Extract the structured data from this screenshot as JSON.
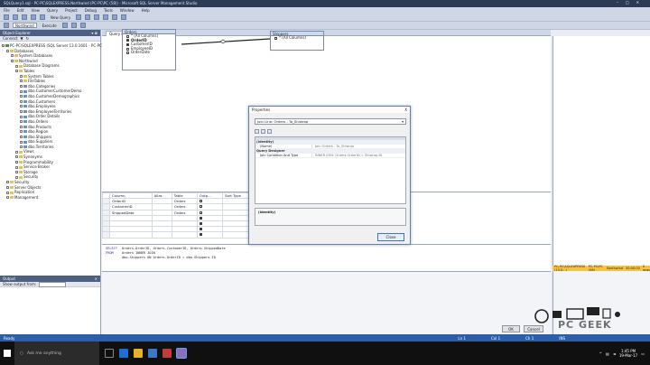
{
  "window": {
    "title": "SQLQuery1.sql - PC-PC\\SQLEXPRESS.Northwind (PC-PC\\PC (58)) - Microsoft SQL Server Management Studio"
  },
  "menu": [
    "File",
    "Edit",
    "View",
    "Query",
    "Project",
    "Debug",
    "Tools",
    "Window",
    "Help"
  ],
  "toolbar": {
    "new_query": "New Query",
    "database": "Northwind",
    "execute": "Execute"
  },
  "object_explorer": {
    "title": "Object Explorer",
    "connect": "Connect",
    "nodes": [
      {
        "label": "PC-PC\\SQLEXPRESS (SQL Server 13.0.1601 - PC-PC\\PC)",
        "level": 0,
        "kind": "srv"
      },
      {
        "label": "Databases",
        "level": 1,
        "kind": "folder"
      },
      {
        "label": "System Databases",
        "level": 2,
        "kind": "folder"
      },
      {
        "label": "Northwind",
        "level": 2,
        "kind": "folder"
      },
      {
        "label": "Database Diagrams",
        "level": 3,
        "kind": "folder"
      },
      {
        "label": "Tables",
        "level": 3,
        "kind": "folder"
      },
      {
        "label": "System Tables",
        "level": 4,
        "kind": "folder"
      },
      {
        "label": "FileTables",
        "level": 4,
        "kind": "folder"
      },
      {
        "label": "dbo.Categories",
        "level": 4,
        "kind": "tbl"
      },
      {
        "label": "dbo.CustomerCustomerDemo",
        "level": 4,
        "kind": "tbl"
      },
      {
        "label": "dbo.CustomerDemographics",
        "level": 4,
        "kind": "tbl"
      },
      {
        "label": "dbo.Customers",
        "level": 4,
        "kind": "tbl"
      },
      {
        "label": "dbo.Employees",
        "level": 4,
        "kind": "tbl"
      },
      {
        "label": "dbo.EmployeeTerritories",
        "level": 4,
        "kind": "tbl"
      },
      {
        "label": "dbo.Order Details",
        "level": 4,
        "kind": "tbl"
      },
      {
        "label": "dbo.Orders",
        "level": 4,
        "kind": "tbl"
      },
      {
        "label": "dbo.Products",
        "level": 4,
        "kind": "tbl"
      },
      {
        "label": "dbo.Region",
        "level": 4,
        "kind": "tbl"
      },
      {
        "label": "dbo.Shippers",
        "level": 4,
        "kind": "tbl"
      },
      {
        "label": "dbo.Suppliers",
        "level": 4,
        "kind": "tbl"
      },
      {
        "label": "dbo.Territories",
        "level": 4,
        "kind": "tbl"
      },
      {
        "label": "Views",
        "level": 3,
        "kind": "folder"
      },
      {
        "label": "Synonyms",
        "level": 3,
        "kind": "folder"
      },
      {
        "label": "Programmability",
        "level": 3,
        "kind": "folder"
      },
      {
        "label": "Service Broker",
        "level": 3,
        "kind": "folder"
      },
      {
        "label": "Storage",
        "level": 3,
        "kind": "folder"
      },
      {
        "label": "Security",
        "level": 3,
        "kind": "folder"
      },
      {
        "label": "Security",
        "level": 1,
        "kind": "folder"
      },
      {
        "label": "Server Objects",
        "level": 1,
        "kind": "folder"
      },
      {
        "label": "Replication",
        "level": 1,
        "kind": "folder"
      },
      {
        "label": "Management",
        "level": 1,
        "kind": "folder"
      }
    ]
  },
  "output_panel": {
    "title": "Output",
    "source_label": "Show output from:"
  },
  "doc_tab": "Query Designer",
  "diagram": {
    "orders_table": {
      "title": "Orders",
      "columns": [
        {
          "name": "* (All Columns)",
          "checked": false
        },
        {
          "name": "OrderID",
          "checked": true,
          "bold": true
        },
        {
          "name": "CustomerID",
          "checked": true
        },
        {
          "name": "EmployeeID",
          "checked": false
        },
        {
          "name": "OrderDate",
          "checked": false
        }
      ]
    },
    "ship_table": {
      "title": "Shippers",
      "columns": [
        {
          "name": "* (All Columns)",
          "checked": false
        }
      ]
    }
  },
  "criteria_grid": {
    "headers": [
      "Column",
      "Alias",
      "Table",
      "Outp...",
      "Sort Type"
    ],
    "rows": [
      {
        "column": "OrderID",
        "alias": "",
        "table": "Orders",
        "output": true
      },
      {
        "column": "CustomerID",
        "alias": "",
        "table": "Orders",
        "output": true
      },
      {
        "column": "ShippedDate",
        "alias": "",
        "table": "Orders",
        "output": true
      },
      {
        "column": "",
        "alias": "",
        "table": "",
        "output": false
      },
      {
        "column": "",
        "alias": "",
        "table": "",
        "output": false
      },
      {
        "column": "",
        "alias": "",
        "table": "",
        "output": false
      },
      {
        "column": "",
        "alias": "",
        "table": "",
        "output": false
      }
    ]
  },
  "sql": [
    {
      "kw": "SELECT",
      "text": "Orders.OrderID, Orders.CustomerID, Orders.ShippedDate"
    },
    {
      "kw": "FROM",
      "text": "Orders INNER JOIN"
    },
    {
      "kw": "",
      "text": "dbo.Shippers ON Orders.OrderID = dbo.Shippers.ID"
    }
  ],
  "buttons": {
    "ok": "OK",
    "cancel": "Cancel"
  },
  "status_right": [
    "PC-PC\\SQLEXPRESS (13.0...)",
    "PC-PC\\PC (58)",
    "Northwind",
    "00:00:00",
    "0 rows"
  ],
  "statusbar": {
    "left": "Ready",
    "ln": "Ln 1",
    "col": "Col 1",
    "ch": "Ch 1",
    "mode": "INS"
  },
  "properties_dialog": {
    "title": "Properties",
    "close": "X",
    "selector": "Join Line: Orders - To_Shiwrap",
    "categories": [
      {
        "name": "(Identity)",
        "props": [
          {
            "key": "(Name)",
            "value": "Join Orders - To_Shiwrap"
          }
        ]
      },
      {
        "name": "Query Designer",
        "props": [
          {
            "key": "Join Condition And Type",
            "value": "INNER JOIN: Orders.OrderID = Shiwrap.ID"
          }
        ]
      }
    ],
    "description_title": "(Identity)",
    "close_button": "Close"
  },
  "taskbar": {
    "search_placeholder": "Ask me anything",
    "time": "1:45 PM",
    "date": "19-Mar-17"
  },
  "watermark": "PC GEEK",
  "colors": {
    "accent": "#2d5fa8",
    "titlebar": "#2b3a55",
    "status_yellow": "#f6c343"
  }
}
